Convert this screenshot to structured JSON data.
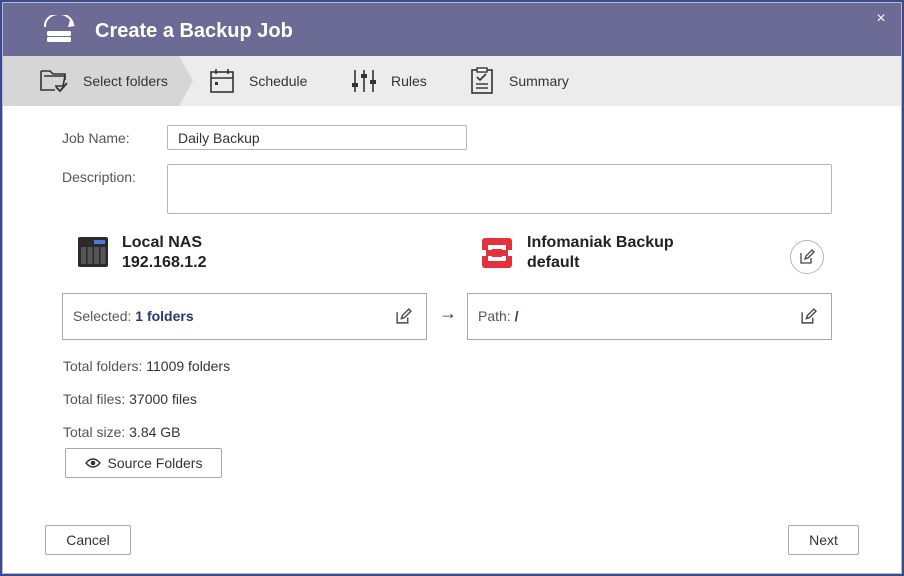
{
  "dialog": {
    "title": "Create a Backup Job",
    "close_glyph": "×"
  },
  "steps": [
    {
      "label": "Select folders",
      "icon": "folder-check-icon",
      "active": true
    },
    {
      "label": "Schedule",
      "icon": "calendar-icon",
      "active": false
    },
    {
      "label": "Rules",
      "icon": "sliders-icon",
      "active": false
    },
    {
      "label": "Summary",
      "icon": "clipboard-icon",
      "active": false
    }
  ],
  "form": {
    "job_name_label": "Job Name:",
    "job_name_value": "Daily Backup",
    "description_label": "Description:",
    "description_value": ""
  },
  "source": {
    "name": "Local NAS",
    "address": "192.168.1.2",
    "selected_label": "Selected:",
    "selected_value": "1 folders"
  },
  "destination": {
    "name": "Infomaniak Backup",
    "profile": "default",
    "path_label": "Path:",
    "path_value": "/",
    "brand_color": "#e4323c"
  },
  "arrow_glyph": "→",
  "stats": {
    "total_folders_label": "Total folders:",
    "total_folders_value": "11009 folders",
    "total_files_label": "Total files:",
    "total_files_value": "37000 files",
    "total_size_label": "Total size:",
    "total_size_value": "3.84 GB"
  },
  "buttons": {
    "source_folders": "Source Folders",
    "cancel": "Cancel",
    "next": "Next"
  },
  "colors": {
    "titlebar": "#6b6b96",
    "accent_text": "#2c3670"
  }
}
